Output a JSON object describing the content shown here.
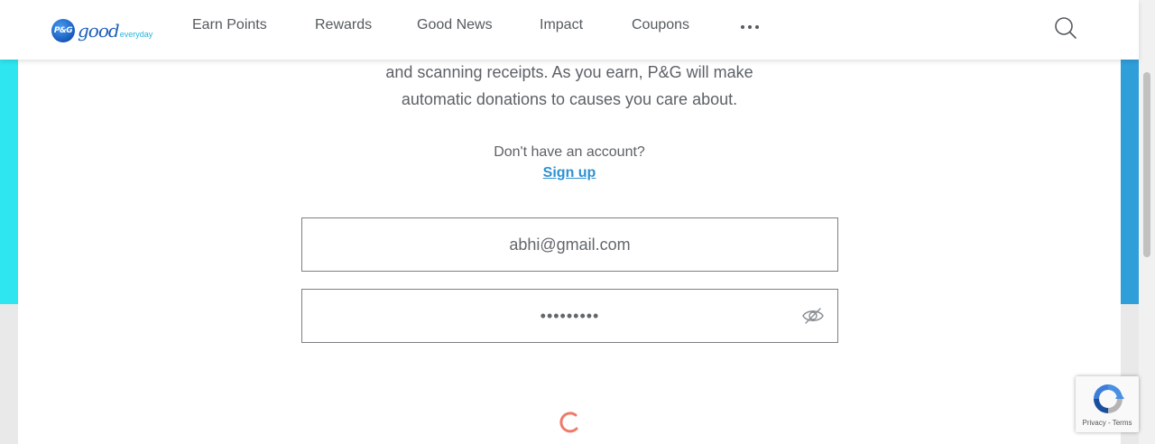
{
  "header": {
    "logo": {
      "badge": "P&G",
      "good": "good",
      "everyday": "everyday"
    },
    "nav": {
      "earn_points": "Earn Points",
      "rewards": "Rewards",
      "good_news": "Good News",
      "impact": "Impact",
      "coupons": "Coupons"
    },
    "more_icon": "more-horizontal-icon",
    "search_icon": "search-icon"
  },
  "intro": {
    "line1": "and scanning receipts. As you earn, P&G will make",
    "line2": "automatic donations to causes you care about."
  },
  "account": {
    "no_account_text": "Don't have an account?",
    "signup_label": "Sign up"
  },
  "form": {
    "email_value": "abhi@gmail.com",
    "password_value": "•••••••••",
    "password_toggle_icon": "eye-slash-icon"
  },
  "loading": {
    "icon": "loading-spinner-icon"
  },
  "recaptcha": {
    "label": "Privacy - Terms"
  },
  "colors": {
    "accent": "#2f91d1",
    "gradient_start": "#2ee6f0",
    "gradient_end": "#2f9ed9",
    "spinner": "#f07a6a",
    "nav_text": "#555a5e"
  }
}
